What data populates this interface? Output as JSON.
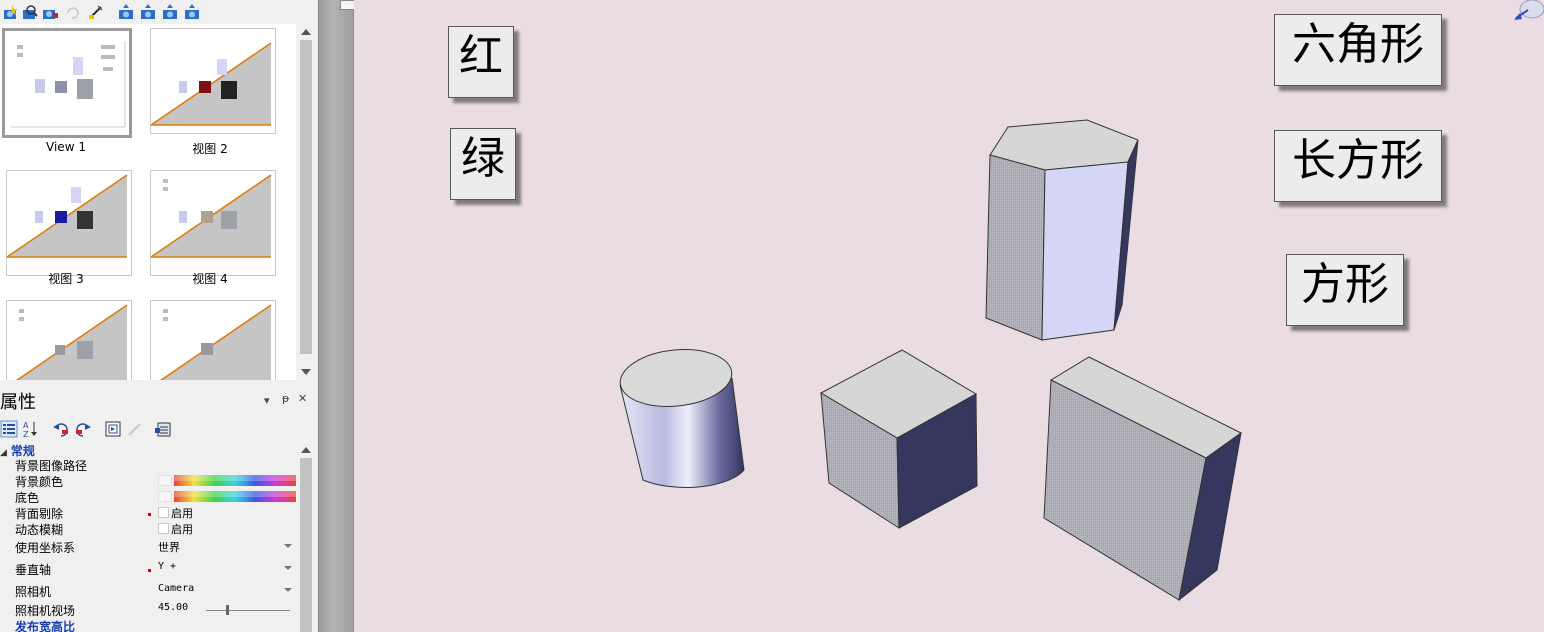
{
  "thumbnails": {
    "items": [
      {
        "label": "View 1"
      },
      {
        "label": "视图 2"
      },
      {
        "label": "视图 3"
      },
      {
        "label": "视图 4"
      },
      {
        "label": ""
      },
      {
        "label": ""
      }
    ]
  },
  "properties": {
    "title": "属性",
    "pin_glyph": "ᵽ",
    "close_glyph": "✕",
    "category": "常规",
    "rows": [
      {
        "name": "背景图像路径",
        "value": ""
      },
      {
        "name": "背景颜色",
        "value": ""
      },
      {
        "name": "底色",
        "value": ""
      },
      {
        "name": "背面剔除",
        "value": "启用"
      },
      {
        "name": "动态模糊",
        "value": "启用"
      },
      {
        "name": "使用坐标系",
        "value": "世界"
      },
      {
        "name": "垂直轴",
        "value": "Y +"
      },
      {
        "name": "照相机",
        "value": "Camera"
      },
      {
        "name": "照相机视场",
        "value": "45.00"
      },
      {
        "name": "发布宽高比",
        "value": ""
      }
    ]
  },
  "viewport": {
    "labels": {
      "red": "红",
      "green": "绿",
      "hexagon": "六角形",
      "rectangle": "长方形",
      "square": "方形"
    }
  },
  "colors": {
    "viewport_bg": "#e9dde3",
    "shape_top": "#d8d8d8",
    "shape_side_light": "#d5d6f5",
    "shape_side_dark": "#3a3c6e",
    "category_text": "#1c3fb0",
    "thumb_accent": "#e07a00"
  }
}
